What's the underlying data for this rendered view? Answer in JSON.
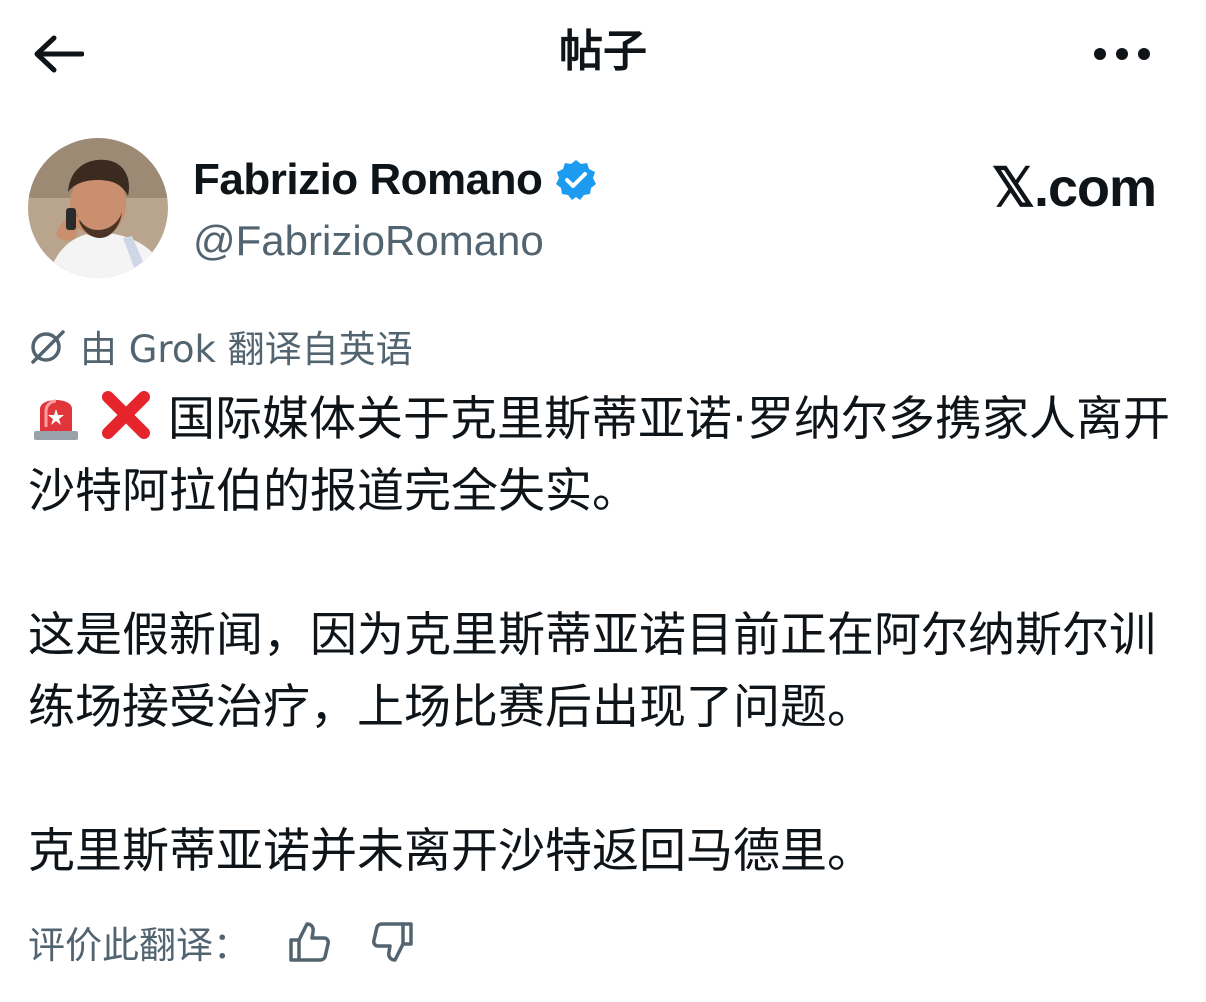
{
  "header": {
    "title": "帖子",
    "back_icon": "arrow-left-icon",
    "more_icon": "more-horizontal-icon"
  },
  "author": {
    "display_name": "Fabrizio Romano",
    "handle": "@FabrizioRomano",
    "verified": true,
    "verified_color": "#1d9bf0",
    "source": "𝕏.com"
  },
  "translation": {
    "label": "由 Grok 翻译自英语",
    "icon": "grok-icon"
  },
  "tweet": {
    "emojis": [
      "police-light-emoji",
      "cross-mark-emoji"
    ],
    "paragraphs": [
      "国际媒体关于克里斯蒂亚诺·罗纳尔多携家人离开沙特阿拉伯的报道完全失实。",
      "这是假新闻，因为克里斯蒂亚诺目前正在阿尔纳斯尔训练场接受治疗，上场比赛后出现了问题。",
      "克里斯蒂亚诺并未离开沙特返回马德里。"
    ]
  },
  "rating": {
    "label": "评价此翻译：",
    "thumbs_up_icon": "thumbs-up-icon",
    "thumbs_down_icon": "thumbs-down-icon"
  },
  "colors": {
    "text_primary": "#0f1419",
    "text_secondary": "#536471",
    "accent": "#1d9bf0"
  }
}
